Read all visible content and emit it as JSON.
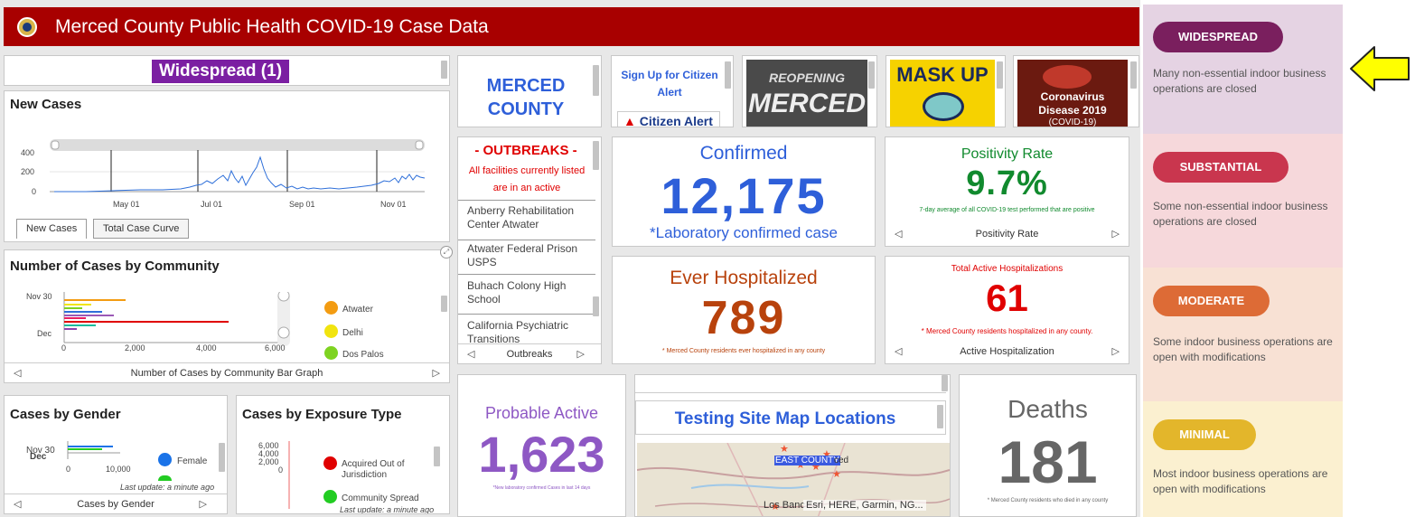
{
  "header": {
    "title": "Merced County Public Health COVID-19 Case Data"
  },
  "tier_banner": {
    "label": "Widespread (1)"
  },
  "new_cases": {
    "title": "New Cases",
    "y_ticks": [
      "400",
      "200",
      "0"
    ],
    "x_ticks": [
      "May 01",
      "Jul 01",
      "Sep 01",
      "Nov 01"
    ],
    "tabs": [
      "New Cases",
      "Total Case Curve"
    ]
  },
  "community": {
    "title": "Number of Cases by Community",
    "y_labels": [
      "Nov 30",
      "Dec"
    ],
    "x_ticks": [
      "0",
      "2,000",
      "4,000",
      "6,000"
    ],
    "legend": [
      {
        "name": "Atwater",
        "color": "#f39c12"
      },
      {
        "name": "Delhi",
        "color": "#f1e40f"
      },
      {
        "name": "Dos Palos",
        "color": "#7ed321"
      }
    ],
    "nav_label": "Number of Cases by Community Bar Graph"
  },
  "gender": {
    "title": "Cases by Gender",
    "y_labels": [
      "Nov 30",
      "Dec"
    ],
    "x_ticks": [
      "0",
      "10,000"
    ],
    "legend": [
      {
        "name": "Female",
        "color": "#1a73e8"
      }
    ],
    "update": "Last update: a minute ago",
    "nav_label": "Cases by Gender"
  },
  "exposure": {
    "title": "Cases by Exposure Type",
    "y_ticks": [
      "6,000",
      "4,000",
      "2,000",
      "0"
    ],
    "legend": [
      {
        "name": "Acquired Out of Jurisdiction",
        "color": "#e00000"
      },
      {
        "name": "Community Spread",
        "color": "#22cc22"
      }
    ],
    "update": "Last update: a minute ago"
  },
  "merced_county": {
    "line1": "MERCED",
    "line2": "COUNTY"
  },
  "citizen_alert": {
    "signup": "Sign Up for Citizen Alert",
    "brand": "Citizen Alert"
  },
  "images": {
    "reopening": {
      "line1": "REOPENING",
      "line2": "MERCED"
    },
    "mask": {
      "text": "MASK UP"
    },
    "corona": {
      "line1": "Coronavirus",
      "line2": "Disease 2019",
      "line3": "(COVID-19)"
    }
  },
  "outbreaks": {
    "title": "- OUTBREAKS -",
    "subtitle": "All facilities currently listed are in an active",
    "items": [
      "Anberry Rehabilitation Center Atwater",
      "Atwater Federal Prison USPS",
      "Buhach Colony High School",
      "California Psychiatric Transitions"
    ],
    "nav_label": "Outbreaks"
  },
  "confirmed": {
    "title": "Confirmed",
    "value": "12,175",
    "caption": "*Laboratory confirmed case"
  },
  "positivity": {
    "title": "Positivity Rate",
    "value": "9.7%",
    "caption": "7-day average of all COVID-19 test performed that are positive",
    "nav_label": "Positivity Rate"
  },
  "hospitalized": {
    "title": "Ever Hospitalized",
    "value": "789",
    "caption": "* Merced County residents ever hospitalized in any county"
  },
  "active_hosp": {
    "title": "Total Active Hospitalizations",
    "value": "61",
    "caption": "* Merced County residents hospitalized in any county.",
    "nav_label": "Active Hospitalization"
  },
  "probable": {
    "title": "Probable Active",
    "value": "1,623",
    "caption": "*New laboratory confirmed Cases in last 14 days"
  },
  "testing_map": {
    "title": "Testing Site Map Locations",
    "label_east": "EAST COUNTY",
    "label_ced": "ced",
    "label_losban": "Los Banc",
    "attribution": "Esri, HERE, Garmin, NG..."
  },
  "deaths": {
    "title": "Deaths",
    "value": "181",
    "caption": "* Merced County residents who died in any county"
  },
  "risk_levels": [
    {
      "label": "WIDESPREAD",
      "desc": "Many non-essential indoor business operations are closed",
      "pill": "#7a1f5e",
      "bg": "#e5d3e3"
    },
    {
      "label": "SUBSTANTIAL",
      "desc": "Some non-essential indoor business operations are closed",
      "pill": "#c9364e",
      "bg": "#f6d8db"
    },
    {
      "label": "MODERATE",
      "desc": "Some indoor business operations are open with modifications",
      "pill": "#dd6b36",
      "bg": "#f8e1d4"
    },
    {
      "label": "MINIMAL",
      "desc": "Most indoor business operations are open with modifications",
      "pill": "#e3b62b",
      "bg": "#fbf0d0"
    }
  ],
  "colors": {
    "header": "#a80000",
    "blue": "#2e5fd9",
    "green": "#118a2e",
    "brown": "#b8420c",
    "red": "#e00000",
    "purple": "#8e58c4",
    "gray": "#666666"
  }
}
